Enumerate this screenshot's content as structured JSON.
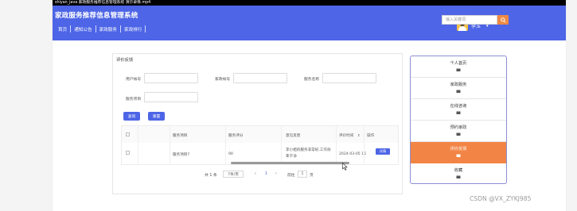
{
  "video_overlay_text": "shiyan_java 家政服务推荐信息管理系统 演示录像.mp4",
  "header": {
    "system_title": "家政服务推荐信息管理系统",
    "nav_items": [
      "首页",
      "通知公告",
      "家政服务",
      "家政排行"
    ],
    "username": "李玉",
    "search_placeholder": "输入关键词"
  },
  "eval_panel": {
    "title": "评价反馈",
    "filters": {
      "user_account_label": "用户帐号",
      "domestic_account_label": "家政帐号",
      "service_name_label": "服务名称",
      "service_item_label": "服务项目"
    },
    "buttons": {
      "search": "查询",
      "reset": "重置"
    }
  },
  "table": {
    "columns": [
      "服务项目",
      "服务评分",
      "意见反馈",
      "评价时间",
      "操作"
    ],
    "sort_arrow": "⇕",
    "rows": [
      {
        "service_item": "服务项目7",
        "score": "90",
        "feedback_line1": "李小姐的服务非常好,工作效",
        "feedback_line2": "率干净",
        "time": "2024-03-05 15",
        "action": "详情"
      }
    ]
  },
  "pagination": {
    "total": "共 1 条",
    "page_size": "7条/页",
    "prev": "‹",
    "current": "1",
    "next": "›",
    "goto_label": "前往",
    "goto_value": "1",
    "page_suffix": "页"
  },
  "side_menu": {
    "items": [
      {
        "label": "个人首页",
        "active": false
      },
      {
        "label": "家政服务",
        "active": false
      },
      {
        "label": "在线咨询",
        "active": false
      },
      {
        "label": "预约家政",
        "active": false
      },
      {
        "label": "评价反馈",
        "active": true
      },
      {
        "label": "收藏",
        "active": false
      }
    ]
  },
  "watermark": "CSDN @VX_ZYKJ985",
  "colors": {
    "primary": "#4d65e6",
    "accent": "#f28546",
    "search_button": "#ee8a43"
  }
}
